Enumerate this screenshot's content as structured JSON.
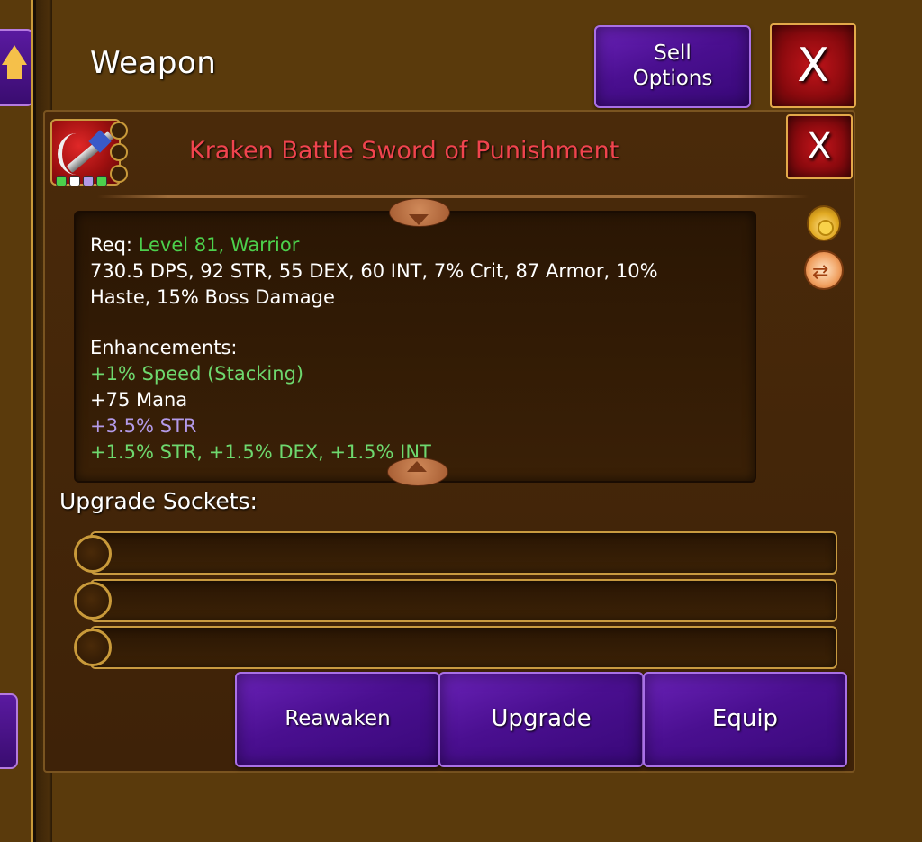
{
  "header": {
    "title": "Weapon",
    "sell_options_label": "Sell\nOptions",
    "close_label": "X"
  },
  "item": {
    "name": "Kraken Battle Sword of Punishment",
    "close_label": "X",
    "icon": "curved-sword-icon",
    "pip_colors": [
      "#4cd04c",
      "#ffffff",
      "#b39ae8",
      "#4cd04c"
    ]
  },
  "description": {
    "req_prefix": "Req: ",
    "req_level": "Level 81",
    "req_sep": ", ",
    "req_class": "Warrior",
    "stats_line1": "730.5 DPS, 92 STR, 55 DEX, 60 INT, 7% Crit, 87 Armor, 10%",
    "stats_line2": "Haste, 15% Boss Damage",
    "enhancements_label": "Enhancements:",
    "enhancements": [
      {
        "text": "+1% Speed (Stacking)",
        "color": "#6ed86e"
      },
      {
        "text": "+75 Mana",
        "color": "#ffffff"
      },
      {
        "text": "+3.5% STR",
        "color": "#b39ae8"
      },
      {
        "text": "+1.5% STR, +1.5% DEX, +1.5% INT",
        "color": "#6ed86e"
      }
    ]
  },
  "side_icons": [
    "gold-bag-icon",
    "swap-icon"
  ],
  "sockets": {
    "label": "Upgrade Sockets:",
    "count": 3
  },
  "actions": {
    "reawaken_label": "Reawaken",
    "upgrade_label": "Upgrade",
    "equip_label": "Equip"
  },
  "colors": {
    "background": "#5a3a0c",
    "item_name": "#f0444e",
    "button_purple": "#4a0f90",
    "button_red": "#a01010",
    "gold_border": "#c89a40"
  }
}
